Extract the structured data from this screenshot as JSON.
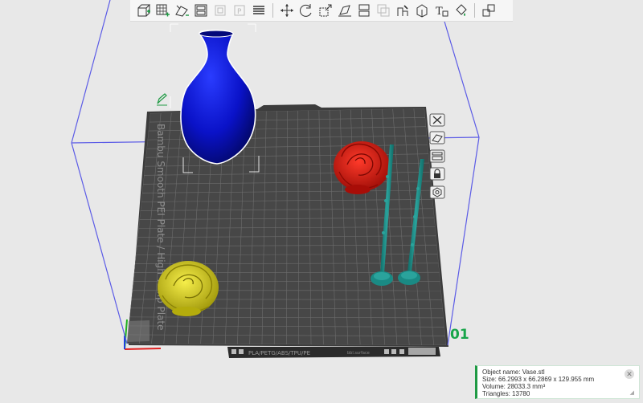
{
  "toolbar": {
    "items": [
      {
        "name": "add-object-icon"
      },
      {
        "name": "add-plate-icon"
      },
      {
        "name": "auto-orient-icon"
      },
      {
        "name": "arrange-icon"
      },
      {
        "name": "split-objects-icon"
      },
      {
        "name": "split-parts-icon"
      },
      {
        "name": "layers-icon"
      },
      {
        "name": "move-icon"
      },
      {
        "name": "rotate-icon"
      },
      {
        "name": "scale-icon"
      },
      {
        "name": "lay-on-face-icon"
      },
      {
        "name": "cut-icon"
      },
      {
        "name": "mesh-boolean-icon"
      },
      {
        "name": "support-paint-icon"
      },
      {
        "name": "seam-paint-icon"
      },
      {
        "name": "text-emboss-icon"
      },
      {
        "name": "color-paint-icon"
      },
      {
        "name": "assembly-view-icon"
      }
    ]
  },
  "plate": {
    "label": "Bambu Smooth PEI Plate / High Temp Plate",
    "number": "01",
    "filament_label": "PLA/PETG/ABS/TPU/PE",
    "bottom_tag": "bbl.surface"
  },
  "plate_tools": [
    {
      "name": "plate-delete-icon"
    },
    {
      "name": "plate-orient-icon"
    },
    {
      "name": "plate-arrange-icon"
    },
    {
      "name": "plate-lock-icon"
    },
    {
      "name": "plate-settings-icon"
    }
  ],
  "object_info": {
    "name_line": "Object name: Vase.stl",
    "size_line": "Size: 66.2993 x 66.2869 x 129.955 mm",
    "volume_line": "Volume: 28033.3 mm³",
    "triangles_line": "Triangles: 13780"
  },
  "colors": {
    "background": "#e8e8e8",
    "plate": "#4a4a4a",
    "grid": "#6e6e6e",
    "build_volume": "#5b5be6",
    "accent": "#1f9a44",
    "vase": "#0a12c8",
    "red_rose": "#d91a12",
    "yellow_rose": "#e0d414",
    "stems": "#1a8a84"
  }
}
